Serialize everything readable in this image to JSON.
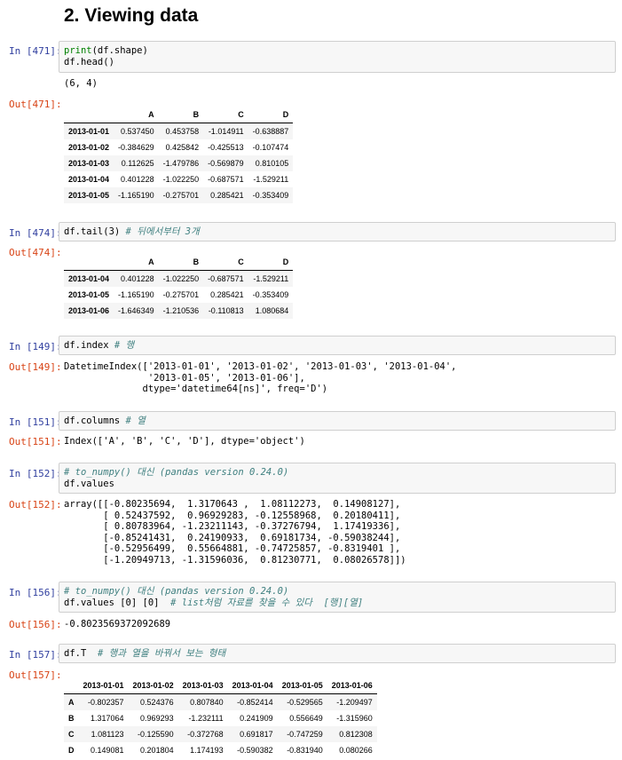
{
  "heading": "2. Viewing data",
  "cells": [
    {
      "in_prompt": "In [471]:",
      "code_lines": [
        "print(df.shape)",
        "df.head()"
      ],
      "stdout": "(6, 4)",
      "out_prompt": "Out[471]:",
      "table": {
        "columns": [
          "",
          "A",
          "B",
          "C",
          "D"
        ],
        "rows": [
          [
            "2013-01-01",
            "0.537450",
            "0.453758",
            "-1.014911",
            "-0.638887"
          ],
          [
            "2013-01-02",
            "-0.384629",
            "0.425842",
            "-0.425513",
            "-0.107474"
          ],
          [
            "2013-01-03",
            "0.112625",
            "-1.479786",
            "-0.569879",
            "0.810105"
          ],
          [
            "2013-01-04",
            "0.401228",
            "-1.022250",
            "-0.687571",
            "-1.529211"
          ],
          [
            "2013-01-05",
            "-1.165190",
            "-0.275701",
            "0.285421",
            "-0.353409"
          ]
        ]
      }
    },
    {
      "in_prompt": "In [474]:",
      "code": "df.tail(3)",
      "comment": "# 뒤에서부터 3개",
      "out_prompt": "Out[474]:",
      "table": {
        "columns": [
          "",
          "A",
          "B",
          "C",
          "D"
        ],
        "rows": [
          [
            "2013-01-04",
            "0.401228",
            "-1.022250",
            "-0.687571",
            "-1.529211"
          ],
          [
            "2013-01-05",
            "-1.165190",
            "-0.275701",
            "0.285421",
            "-0.353409"
          ],
          [
            "2013-01-06",
            "-1.646349",
            "-1.210536",
            "-0.110813",
            "1.080684"
          ]
        ]
      }
    },
    {
      "in_prompt": "In [149]:",
      "code": "df.index",
      "comment": "# 행",
      "out_prompt": "Out[149]:",
      "output": "DatetimeIndex(['2013-01-01', '2013-01-02', '2013-01-03', '2013-01-04',\n               '2013-01-05', '2013-01-06'],\n              dtype='datetime64[ns]', freq='D')"
    },
    {
      "in_prompt": "In [151]:",
      "code": "df.columns",
      "comment": "# 열",
      "out_prompt": "Out[151]:",
      "output": "Index(['A', 'B', 'C', 'D'], dtype='object')"
    },
    {
      "in_prompt": "In [152]:",
      "comment": "# to_numpy() 대신 (pandas version 0.24.0)",
      "code": "df.values",
      "out_prompt": "Out[152]:",
      "output": "array([[-0.80235694,  1.3170643 ,  1.08112273,  0.14908127],\n       [ 0.52437592,  0.96929283, -0.12558968,  0.20180411],\n       [ 0.80783964, -1.23211143, -0.37276794,  1.17419336],\n       [-0.85241431,  0.24190933,  0.69181734, -0.59038244],\n       [-0.52956499,  0.55664881, -0.74725857, -0.8319401 ],\n       [-1.20949713, -1.31596036,  0.81230771,  0.08026578]])"
    },
    {
      "in_prompt": "In [156]:",
      "comment": "# to_numpy() 대신 (pandas version 0.24.0)",
      "code": "df.values [0] [0]",
      "comment2": "# list처럼 자료를 찾을 수 있다  [행][열]",
      "out_prompt": "Out[156]:",
      "output": "-0.8023569372092689"
    },
    {
      "in_prompt": "In [157]:",
      "code": "df.T",
      "comment": "# 행과 열을 바꿔서 보는 형태",
      "out_prompt": "Out[157]:",
      "table": {
        "columns": [
          "",
          "2013-01-01",
          "2013-01-02",
          "2013-01-03",
          "2013-01-04",
          "2013-01-05",
          "2013-01-06"
        ],
        "rows": [
          [
            "A",
            "-0.802357",
            "0.524376",
            "0.807840",
            "-0.852414",
            "-0.529565",
            "-1.209497"
          ],
          [
            "B",
            "1.317064",
            "0.969293",
            "-1.232111",
            "0.241909",
            "0.556649",
            "-1.315960"
          ],
          [
            "C",
            "1.081123",
            "-0.125590",
            "-0.372768",
            "0.691817",
            "-0.747259",
            "0.812308"
          ],
          [
            "D",
            "0.149081",
            "0.201804",
            "1.174193",
            "-0.590382",
            "-0.831940",
            "0.080266"
          ]
        ]
      }
    }
  ]
}
